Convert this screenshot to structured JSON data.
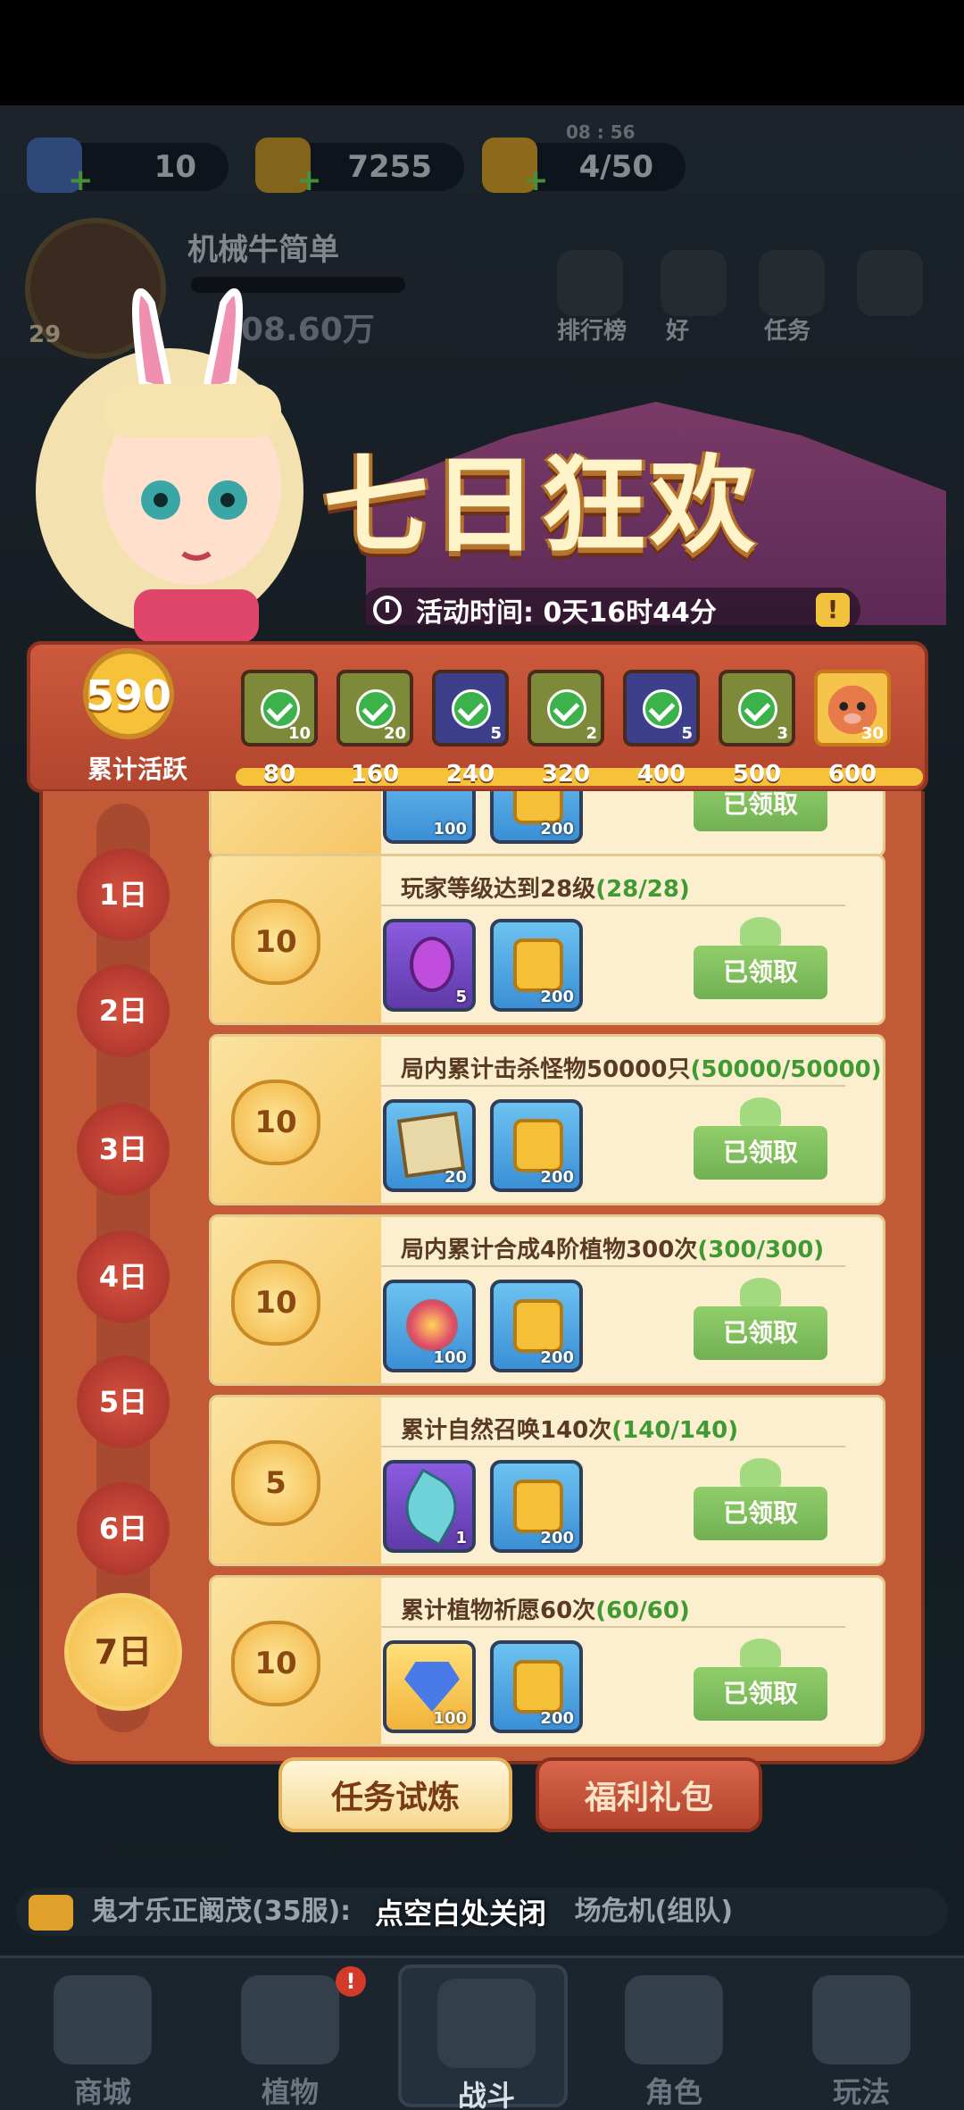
{
  "resources": {
    "gems": "10",
    "gold": "7255",
    "energy": "4/50",
    "energy_timer": "08 : 56"
  },
  "player": {
    "name": "机械牛简单",
    "level": "29",
    "power": "08.60万"
  },
  "top_icons": [
    {
      "label": "排行榜"
    },
    {
      "label": "好"
    },
    {
      "label": "任务"
    }
  ],
  "event": {
    "title": "七日狂欢",
    "time_label": "活动时间: 0天16时44分",
    "activity_points": "590",
    "activity_label": "累计活跃",
    "chests": [
      {
        "count": "10",
        "claimed": true
      },
      {
        "count": "20",
        "claimed": true
      },
      {
        "count": "5",
        "claimed": true
      },
      {
        "count": "2",
        "claimed": true
      },
      {
        "count": "5",
        "claimed": true
      },
      {
        "count": "3",
        "claimed": true
      },
      {
        "count": "30",
        "claimed": false
      }
    ],
    "milestones": [
      "80",
      "160",
      "240",
      "320",
      "400",
      "500",
      "600"
    ]
  },
  "days": [
    "1日",
    "2日",
    "3日",
    "4日",
    "5日",
    "6日",
    "7日"
  ],
  "active_day": "7日",
  "tasks": [
    {
      "points": "10",
      "title": "玩家等级达到28级",
      "progress": "(28/28)",
      "rewards": [
        {
          "icon": "potion-icon",
          "count": "5"
        },
        {
          "icon": "coin-icon",
          "count": "200"
        }
      ],
      "button": "已领取"
    },
    {
      "points": "10",
      "title": "局内累计击杀怪物50000只",
      "progress": "(50000/50000)",
      "rewards": [
        {
          "icon": "map-icon",
          "count": "20"
        },
        {
          "icon": "coin-icon",
          "count": "200"
        }
      ],
      "button": "已领取"
    },
    {
      "points": "10",
      "title": "局内累计合成4阶植物300次",
      "progress": "(300/300)",
      "rewards": [
        {
          "icon": "seed-icon",
          "count": "100"
        },
        {
          "icon": "coin-icon",
          "count": "200"
        }
      ],
      "button": "已领取"
    },
    {
      "points": "5",
      "title": "累计自然召唤140次",
      "progress": "(140/140)",
      "rewards": [
        {
          "icon": "leaf-icon",
          "count": "1"
        },
        {
          "icon": "coin-icon",
          "count": "200"
        }
      ],
      "button": "已领取"
    },
    {
      "points": "10",
      "title": "累计植物祈愿60次",
      "progress": "(60/60)",
      "rewards": [
        {
          "icon": "gem-icon",
          "count": "100"
        },
        {
          "icon": "coin-icon",
          "count": "200"
        }
      ],
      "button": "已领取"
    }
  ],
  "partial_task": {
    "rewards": [
      {
        "count": "100"
      },
      {
        "count": "200"
      }
    ],
    "button": "已领取"
  },
  "tabs": {
    "trial": "任务试炼",
    "gift": "福利礼包"
  },
  "chat": {
    "text": "鬼才乐正阚茂(35服):",
    "text2": "场危机(组队)"
  },
  "close_hint": "点空白处关闭",
  "bottom_nav": [
    "商城",
    "植物",
    "战斗",
    "角色",
    "玩法"
  ],
  "colors": {
    "panel": "#c25a38",
    "claimed_green": "#5aa63e",
    "gold": "#f6c23a"
  }
}
